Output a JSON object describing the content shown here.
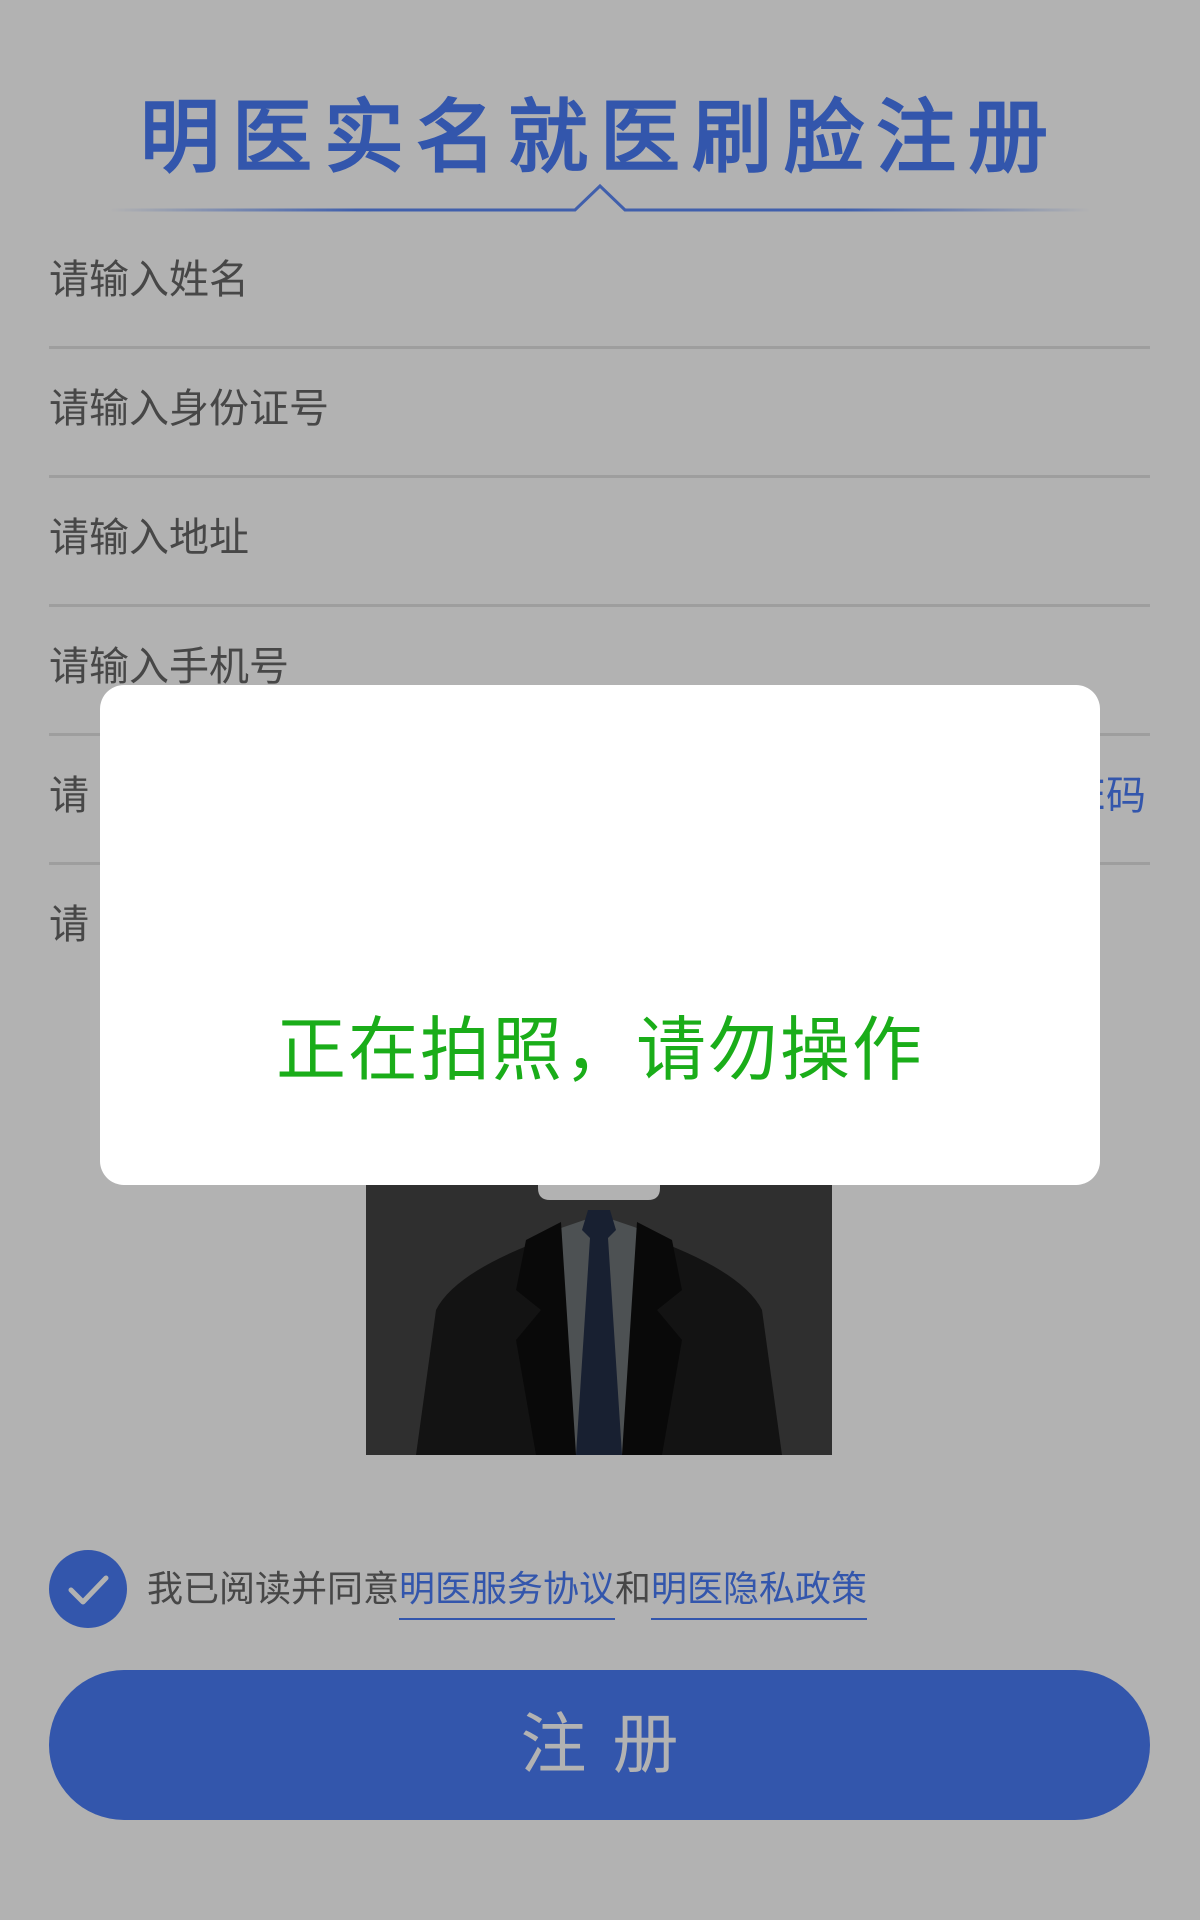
{
  "header": {
    "title": "明医实名就医刷脸注册"
  },
  "form": {
    "name_placeholder": "请输入姓名",
    "id_placeholder": "请输入身份证号",
    "address_placeholder": "请输入地址",
    "phone_placeholder": "请输入手机号",
    "code_placeholder_visible": "请",
    "code_action_visible": "E码",
    "field6_visible": "请"
  },
  "photo": {
    "icon": "camera-icon"
  },
  "agreement": {
    "checked": true,
    "prefix": "我已阅读并同意",
    "service_link": "明医服务协议",
    "joiner": "和",
    "privacy_link": "明医隐私政策"
  },
  "actions": {
    "register_label": "注册"
  },
  "dialog": {
    "message": "正在拍照，请勿操作"
  },
  "colors": {
    "accent": "#4a7cf6",
    "success_text": "#1aad19"
  }
}
